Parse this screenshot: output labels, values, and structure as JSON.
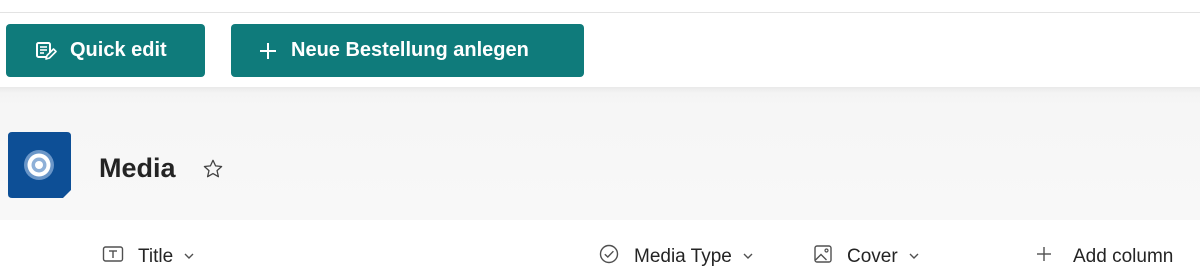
{
  "command_bar": {
    "quick_edit_label": "Quick edit",
    "new_order_label": "Neue Bestellung anlegen",
    "button_color": "#0f7b7b"
  },
  "list": {
    "title": "Media",
    "logo_color": "#0d4f96"
  },
  "columns": [
    {
      "label": "Title",
      "icon": "text-field-icon"
    },
    {
      "label": "Media Type",
      "icon": "choice-check-icon"
    },
    {
      "label": "Cover",
      "icon": "image-icon"
    }
  ],
  "add_column_label": "Add column"
}
